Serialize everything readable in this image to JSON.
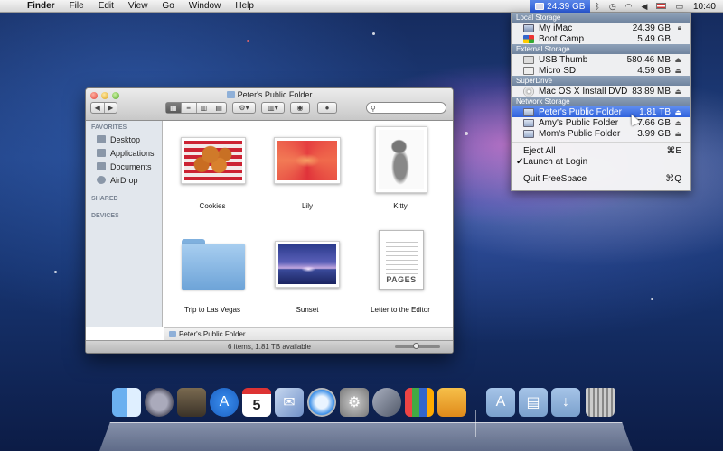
{
  "menubar": {
    "app_name": "Finder",
    "menus": [
      "File",
      "Edit",
      "View",
      "Go",
      "Window",
      "Help"
    ],
    "freespace_value": "24.39 GB",
    "clock": "10:40"
  },
  "dropdown": {
    "sections": [
      {
        "header": "Local Storage",
        "items": [
          {
            "name": "My iMac",
            "size": "24.39 GB",
            "icon": "imac-icon",
            "flag": "lock"
          },
          {
            "name": "Boot Camp",
            "size": "5.49 GB",
            "icon": "bootcamp-icon",
            "flag": ""
          }
        ]
      },
      {
        "header": "External Storage",
        "items": [
          {
            "name": "USB Thumb",
            "size": "580.46 MB",
            "icon": "usb-drive-icon",
            "flag": "eject"
          },
          {
            "name": "Micro SD",
            "size": "4.59 GB",
            "icon": "sd-card-icon",
            "flag": "eject"
          }
        ]
      },
      {
        "header": "SuperDrive",
        "items": [
          {
            "name": "Mac OS X Install DVD",
            "size": "83.89 MB",
            "icon": "dvd-icon",
            "flag": "eject"
          }
        ]
      },
      {
        "header": "Network Storage",
        "items": [
          {
            "name": "Peter's Public Folder",
            "size": "1.81 TB",
            "icon": "network-drive-icon",
            "flag": "eject",
            "selected": true
          },
          {
            "name": "Amy's Public Folder",
            "size": "7.66 GB",
            "icon": "network-drive-icon",
            "flag": "eject"
          },
          {
            "name": "Mom's Public Folder",
            "size": "3.99 GB",
            "icon": "network-drive-icon",
            "flag": "eject"
          }
        ]
      }
    ],
    "commands": [
      {
        "label": "Eject All",
        "shortcut": "⌘E",
        "checked": false
      },
      {
        "label": "Launch at Login",
        "shortcut": "",
        "checked": true
      }
    ],
    "quit": {
      "label": "Quit FreeSpace",
      "shortcut": "⌘Q"
    }
  },
  "finder": {
    "title": "Peter's Public Folder",
    "search_placeholder": "",
    "sidebar": {
      "favorites_header": "FAVORITES",
      "favorites": [
        "Desktop",
        "Applications",
        "Documents",
        "AirDrop"
      ],
      "shared_header": "SHARED",
      "devices_header": "DEVICES"
    },
    "items": [
      {
        "name": "Cookies",
        "kind": "image"
      },
      {
        "name": "Lily",
        "kind": "image"
      },
      {
        "name": "Kitty",
        "kind": "image"
      },
      {
        "name": "Trip to Las Vegas",
        "kind": "folder"
      },
      {
        "name": "Sunset",
        "kind": "image"
      },
      {
        "name": "Letter to the Editor",
        "kind": "document",
        "badge": "PAGES"
      }
    ],
    "path": "Peter's Public Folder",
    "status": "6 items, 1.81 TB available"
  },
  "dock": {
    "apps": [
      "finder-icon",
      "launchpad-icon",
      "photo-booth-icon",
      "app-store-icon",
      "calendar-icon",
      "mail-icon",
      "safari-icon",
      "system-preferences-icon",
      "script-editor-icon",
      "keynote-icon",
      "pages-icon"
    ],
    "calendar_day": "5",
    "stacks": [
      "applications-stack-icon",
      "documents-stack-icon",
      "downloads-stack-icon",
      "trash-icon"
    ]
  }
}
